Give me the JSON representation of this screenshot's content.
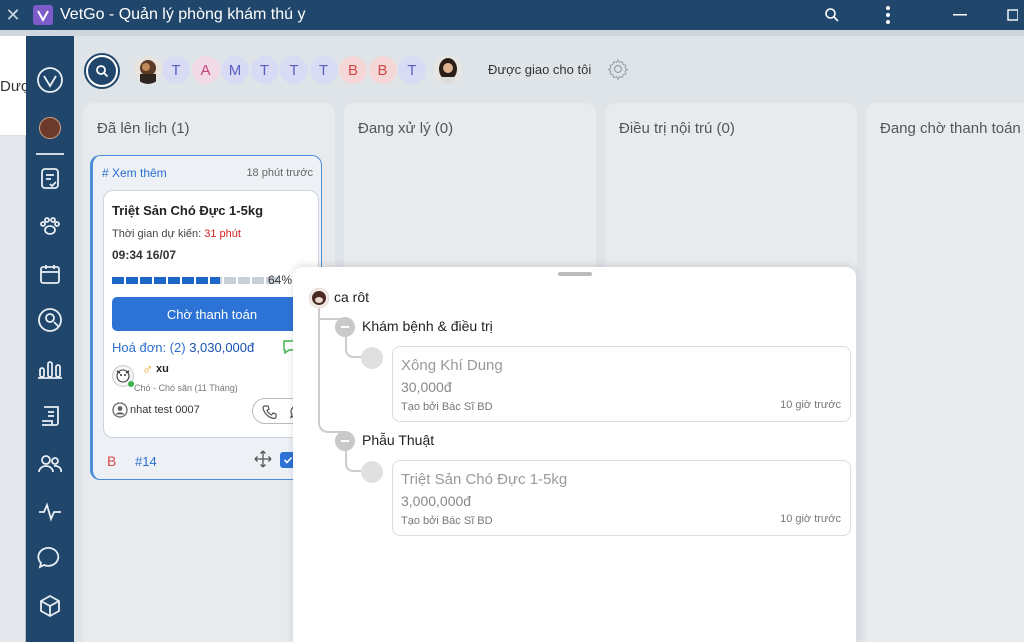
{
  "window": {
    "title": "VetGo - Quản lý phòng khám thú y"
  },
  "background_window": {
    "partial_text": "Dược"
  },
  "sidebar": {
    "items": [
      "logo",
      "avatar",
      "tasks",
      "pets",
      "calendar",
      "search-user",
      "reports",
      "documents",
      "staff",
      "health",
      "chat",
      "products"
    ]
  },
  "topbar": {
    "letter_avatars": [
      {
        "letter": "T",
        "bg": "#d9dbf5",
        "fg": "#5a5fc2"
      },
      {
        "letter": "A",
        "bg": "#f1d9e6",
        "fg": "#c2457e"
      },
      {
        "letter": "M",
        "bg": "#d9dbf5",
        "fg": "#5a5fc2"
      },
      {
        "letter": "T",
        "bg": "#d9dbf5",
        "fg": "#5a5fc2"
      },
      {
        "letter": "T",
        "bg": "#d9dbf5",
        "fg": "#5a5fc2"
      },
      {
        "letter": "T",
        "bg": "#d9dbf5",
        "fg": "#5a5fc2"
      },
      {
        "letter": "B",
        "bg": "#f6d7d7",
        "fg": "#d04848"
      },
      {
        "letter": "B",
        "bg": "#f6d7d7",
        "fg": "#d04848"
      },
      {
        "letter": "T",
        "bg": "#d9dbf5",
        "fg": "#5a5fc2"
      }
    ],
    "assigned_label": "Được giao cho tôi"
  },
  "columns": [
    {
      "title": "Đã lên lịch (1)"
    },
    {
      "title": "Đang xử lý (0)"
    },
    {
      "title": "Điều trị nội trú (0)"
    },
    {
      "title": "Đang chờ thanh toán"
    }
  ],
  "card": {
    "more_link": "# Xem thêm",
    "time_ago": "18 phút trước",
    "service_name": "Triệt Sản Chó Đực 1-5kg",
    "estimate_label": "Thời gian dự kiến:",
    "estimate_value": "31 phút",
    "datetime": "09:34 16/07",
    "progress_percent": 64,
    "progress_label": "64%",
    "pay_button": "Chờ thanh toán",
    "invoice_label": "Hoá đơn: (2)",
    "invoice_amount": "3,030,000đ",
    "pet_name": "xu",
    "pet_info": "Chó - Chó săn (11 Tháng)",
    "owner_name": "nhat test 0007",
    "tag_letter": "B",
    "number": "#14"
  },
  "sheet": {
    "pet_name": "ca rôt",
    "groups": [
      {
        "name": "Khám bệnh & điều trị",
        "items": [
          {
            "name": "Xông Khí Dung",
            "price": "30,000đ",
            "created_by": "Tạo bởi Bác Sĩ BD",
            "time_ago": "10 giờ trước"
          }
        ]
      },
      {
        "name": "Phẫu Thuật",
        "items": [
          {
            "name": "Triệt Sản Chó Đực 1-5kg",
            "price": "3,000,000đ",
            "created_by": "Tạo bởi Bác Sĩ BD",
            "time_ago": "10 giờ trước"
          }
        ]
      }
    ]
  }
}
